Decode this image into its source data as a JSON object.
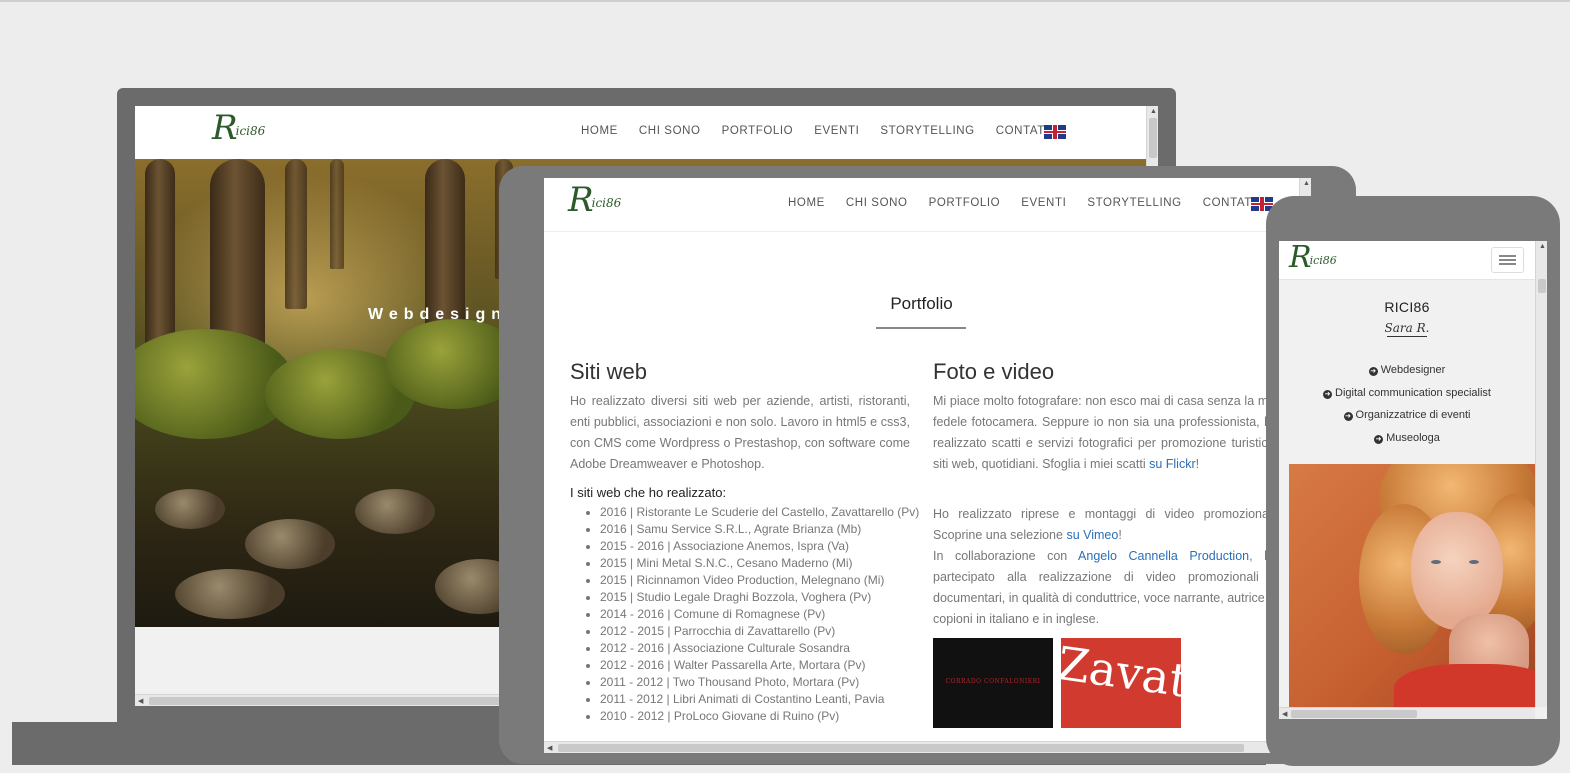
{
  "brand": {
    "logo_mark": "R",
    "logo_text": "ici86"
  },
  "nav": {
    "items": [
      "HOME",
      "CHI SONO",
      "PORTFOLIO",
      "EVENTI",
      "STORYTELLING",
      "CONTATTI"
    ],
    "language_flag_icon": "uk-flag-icon"
  },
  "laptop": {
    "hero_text": "Webdesign"
  },
  "tablet": {
    "section_title": "Portfolio",
    "websites": {
      "heading": "Siti web",
      "intro": "Ho realizzato diversi siti web per aziende, artisti, ristoranti, enti pubblici, associazioni e non solo. Lavoro in html5 e css3, con CMS come Wordpress o Prestashop, con software come Adobe Dreamweaver e Photoshop.",
      "list_heading": "I siti web che ho realizzato:",
      "list": [
        "2016 | Ristorante Le Scuderie del Castello, Zavattarello (Pv)",
        "2016 | Samu Service S.R.L., Agrate Brianza (Mb)",
        "2015 - 2016 | Associazione Anemos, Ispra (Va)",
        "2015 | Mini Metal S.N.C., Cesano Maderno (Mi)",
        "2015 | Ricinnamon Video Production, Melegnano (Mi)",
        "2015 | Studio Legale Draghi Bozzola, Voghera (Pv)",
        "2014 - 2016 | Comune di Romagnese (Pv)",
        "2012 - 2015 | Parrocchia di Zavattarello (Pv)",
        "2012 - 2016 | Associazione Culturale Sosandra",
        "2012 - 2016 | Walter Passarella Arte, Mortara (Pv)",
        "2011 - 2012 | Two Thousand Photo, Mortara (Pv)",
        "2011 - 2012 | Libri Animati di Costantino Leanti, Pavia",
        "2010 - 2012 | ProLoco Giovane di Ruino (Pv)"
      ]
    },
    "photo_video": {
      "heading": "Foto e video",
      "para1_text": "Mi piace molto fotografare: non esco mai di casa senza la mia fedele fotocamera. Seppure io non sia una professionista, ho realizzato scatti e servizi fotografici per promozione turistica, siti web, quotidiani. Sfoglia i miei scatti ",
      "para1_link": "su Flickr",
      "para1_end": "!",
      "para2_text": "Ho realizzato riprese e montaggi di video promozionali. Scoprine una selezione ",
      "para2_link": "su Vimeo",
      "para2_end": "!",
      "para3_text": "In collaborazione con ",
      "para3_link": "Angelo Cannella Production",
      "para3_end": ", ho partecipato alla realizzazione di video promozionali e documentari, in qualità di conduttrice, voce narrante, autrice di copioni in italiano e in inglese.",
      "thumb1_text": "CORRADO CONFALONIERI",
      "thumb2_text": "Zavatta"
    }
  },
  "phone": {
    "name": "RICI86",
    "signature": "Sara R.",
    "roles": [
      "Webdesigner",
      "Digital communication specialist",
      "Organizzatrice di eventi",
      "Museologa"
    ],
    "menu_icon": "hamburger-menu-icon"
  },
  "colors": {
    "background": "#ededed",
    "device_frame": "#6b6b6b",
    "brand_green": "#2c5a2a",
    "link_blue": "#2a6fb8"
  }
}
